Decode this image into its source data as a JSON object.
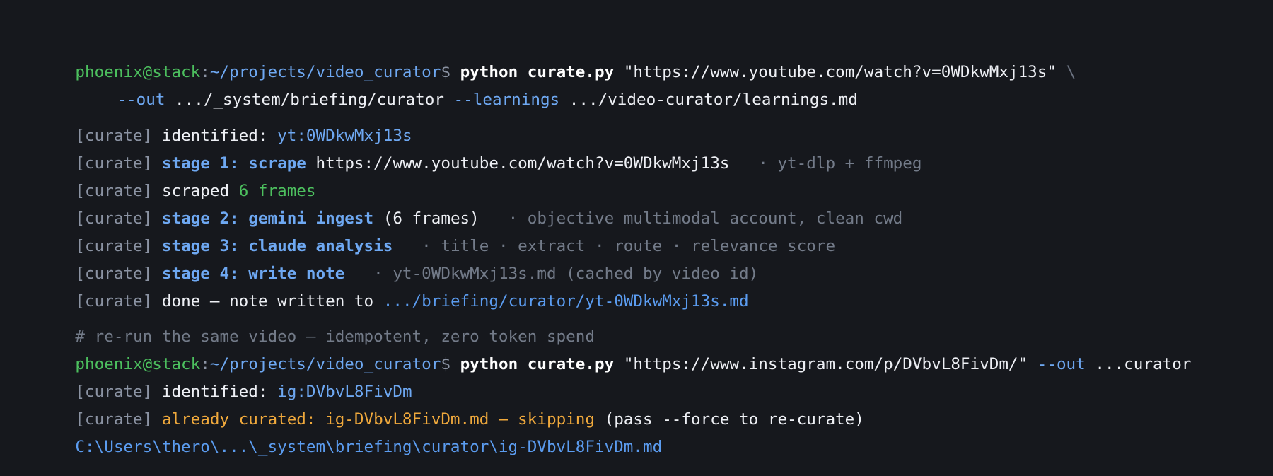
{
  "prompt": {
    "user": "phoenix@stack",
    "colon": ":",
    "path": "~/projects/video_curator",
    "dollar": "$"
  },
  "command1": {
    "cmd": "python curate.py",
    "url_arg": "\"https://www.youtube.com/watch?v=0WDkwMxj13s\"",
    "continuation": "\\",
    "out_flag": "--out",
    "out_value": ".../_system/briefing/curator",
    "learnings_flag": "--learnings",
    "learnings_value": ".../video-curator/learnings.md"
  },
  "tag": "[curate]",
  "run1": {
    "identified_label": "identified:",
    "identified_id": "yt:0WDkwMxj13s",
    "stage1_label": "stage 1: scrape",
    "stage1_url": "https://www.youtube.com/watch?v=0WDkwMxj13s",
    "stage1_note": "· yt-dlp + ffmpeg",
    "scraped_label": "scraped",
    "scraped_count": "6 frames",
    "stage2_label": "stage 2: gemini ingest",
    "stage2_detail": "(6 frames)",
    "stage2_note": "· objective multimodal account, clean cwd",
    "stage3_label": "stage 3: claude analysis",
    "stage3_note": "· title · extract · route · relevance score",
    "stage4_label": "stage 4: write note",
    "stage4_note": "· yt-0WDkwMxj13s.md (cached by video id)",
    "done_label": "done — note written to",
    "done_path": ".../briefing/curator/yt-0WDkwMxj13s.md"
  },
  "comment": "# re-run the same video — idempotent, zero token spend",
  "command2": {
    "cmd": "python curate.py",
    "url_arg": "\"https://www.instagram.com/p/DVbvL8FivDm/\"",
    "out_flag": "--out",
    "out_value": "...curator"
  },
  "run2": {
    "identified_label": "identified:",
    "identified_id": "ig:DVbvL8FivDm",
    "skip_message": "already curated: ig-DVbvL8FivDm.md — skipping",
    "skip_hint": "(pass --force to re-curate)",
    "output_path": "C:\\Users\\thero\\...\\_system\\briefing\\curator\\ig-DVbvL8FivDm.md"
  }
}
